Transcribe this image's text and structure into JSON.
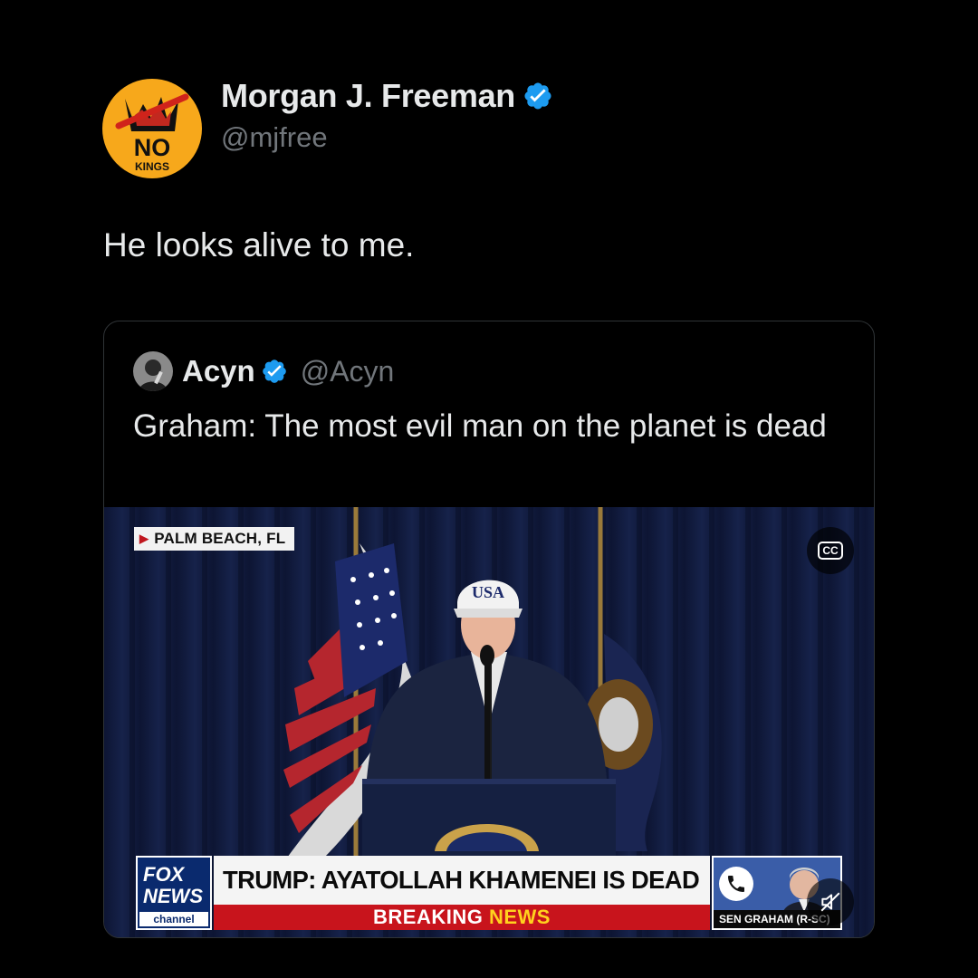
{
  "author": {
    "display_name": "Morgan J. Freeman",
    "handle": "@mjfree",
    "avatar_text_top": "NO",
    "avatar_text_bottom": "KINGS",
    "verified": true
  },
  "tweet_text": "He looks alive to me.",
  "quoted_tweet": {
    "display_name": "Acyn",
    "handle": "@Acyn",
    "verified": true,
    "text": "Graham: The most evil man on the planet is dead"
  },
  "video": {
    "location_tag": "PALM BEACH, FL",
    "cc_label": "CC",
    "hat_text": "USA",
    "chyron": {
      "network_line1": "FOX",
      "network_line2": "NEWS",
      "network_line3": "channel",
      "headline": "TRUMP: AYATOLLAH KHAMENEI IS DEAD",
      "breaking_word1": "BREAKING",
      "breaking_word2": "NEWS",
      "inset_caption": "SEN GRAHAM (R-SC)"
    }
  },
  "colors": {
    "background": "#000000",
    "primary_text": "#e7e9ea",
    "secondary_text": "#71767b",
    "verified_blue": "#1d9bf0",
    "card_border": "#2f3336",
    "avatar_yellow": "#f7a81b",
    "breaking_red": "#c8141c"
  }
}
